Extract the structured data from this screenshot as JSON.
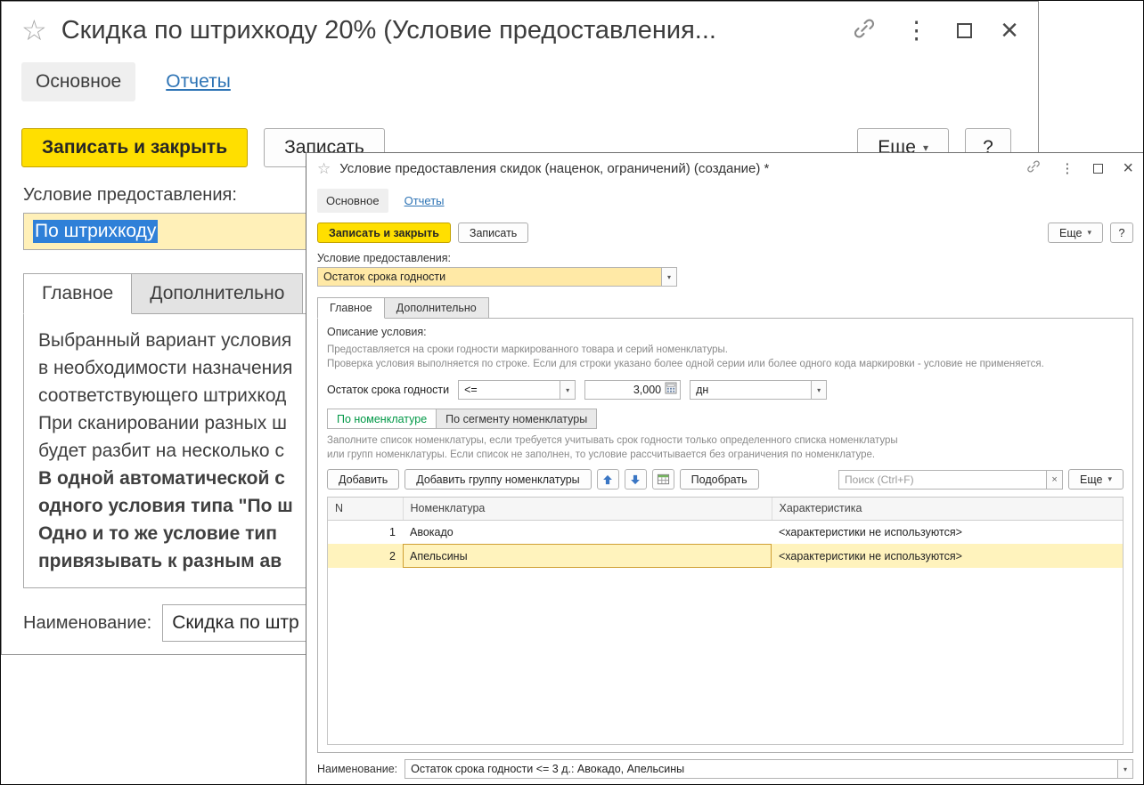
{
  "icons": {
    "star": "☆",
    "kebab": "⋮",
    "close": "×",
    "chevron_down": "▾",
    "clear_x": "×"
  },
  "back": {
    "title": "Скидка по штрихкоду 20% (Условие предоставления...",
    "tab_main": "Основное",
    "tab_reports": "Отчеты",
    "btn_save_close": "Записать и закрыть",
    "btn_save": "Записать",
    "btn_more": "Еще",
    "btn_help": "?",
    "cond_label": "Условие предоставления:",
    "cond_value": "По штрихкоду",
    "tab_glavnoe": "Главное",
    "tab_dop": "Дополнительно",
    "desc": [
      "Выбранный вариант условия",
      "в необходимости назначения",
      "соответствующего штрихкод",
      "При сканировании разных ш",
      "будет разбит на несколько с",
      "В одной автоматической с",
      "одного условия типа \"По ш",
      "Одно и то же условие тип",
      "привязывать к разным ав"
    ],
    "name_label": "Наименование:",
    "name_value": "Скидка по штр"
  },
  "front": {
    "title": "Условие предоставления скидок (наценок, ограничений) (создание) *",
    "tab_main": "Основное",
    "tab_reports": "Отчеты",
    "btn_save_close": "Записать и закрыть",
    "btn_save": "Записать",
    "btn_more": "Еще",
    "btn_help": "?",
    "cond_label": "Условие предоставления:",
    "cond_value": "Остаток срока годности",
    "tab_glavnoe": "Главное",
    "tab_dop": "Дополнительно",
    "desc_label": "Описание условия:",
    "desc_line1": "Предоставляется на сроки годности маркированного товара и серий номенклатуры.",
    "desc_line2": "Проверка условия выполняется по строке. Если для строки указано более одной серии или более одного кода маркировки - условие не применяется.",
    "expiry_label": "Остаток срока годности",
    "operator_value": "<=",
    "days_value": "3,000",
    "unit_value": "дн",
    "toggle_nom": "По номенклатуре",
    "toggle_seg": "По сегменту номенклатуры",
    "fill_line1": "Заполните список номенклатуры, если требуется учитывать срок годности только определенного списка номенклатуры",
    "fill_line2": "или групп номенклатуры. Если список не заполнен, то условие рассчитывается без ограничения по номенклатуре.",
    "btn_add": "Добавить",
    "btn_add_group": "Добавить группу номенклатуры",
    "btn_pick": "Подобрать",
    "search_placeholder": "Поиск (Ctrl+F)",
    "btn_more_list": "Еще",
    "col_n": "N",
    "col_nom": "Номенклатура",
    "col_char": "Характеристика",
    "rows": [
      {
        "n": "1",
        "nom": "Авокадо",
        "char": "<характеристики не используются>"
      },
      {
        "n": "2",
        "nom": "Апельсины",
        "char": "<характеристики не используются>"
      }
    ],
    "name_label": "Наименование:",
    "name_value": "Остаток срока годности <= 3 д.: Авокадо, Апельсины"
  }
}
